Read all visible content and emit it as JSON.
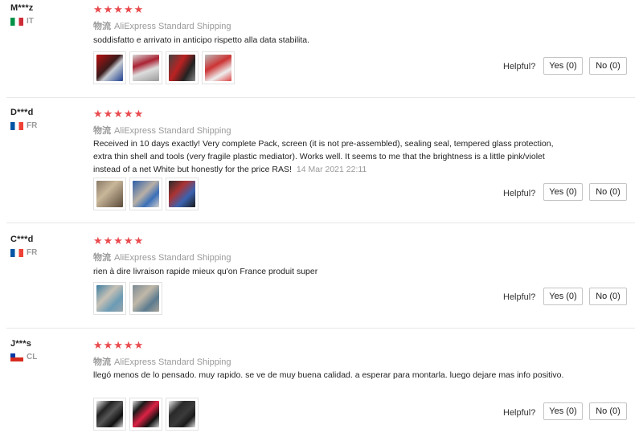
{
  "helpful_label": "Helpful?",
  "shipping_prefix": "物流",
  "reviews": [
    {
      "user": "M***z",
      "country": "IT",
      "stars": "★★★★★",
      "shipping": "AliExpress Standard Shipping",
      "text": "soddisfatto e arrivato in anticipo rispetto alla data stabilita.",
      "date": "",
      "yes_label": "Yes (0)",
      "no_label": "No (0)"
    },
    {
      "user": "D***d",
      "country": "FR",
      "stars": "★★★★★",
      "shipping": "AliExpress Standard Shipping",
      "text": "Received in 10 days exactly! Very complete Pack, screen (it is not pre-assembled), sealing seal, tempered glass protection, extra thin shell and tools (very fragile plastic mediator). Works well. It seems to me that the brightness is a little pink/violet instead of a net White but honestly for the price RAS!",
      "date": "14 Mar 2021 22:11",
      "yes_label": "Yes (0)",
      "no_label": "No (0)"
    },
    {
      "user": "C***d",
      "country": "FR",
      "stars": "★★★★★",
      "shipping": "AliExpress Standard Shipping",
      "text": "rien à dire livraison rapide mieux qu'on France produit super",
      "date": "",
      "yes_label": "Yes (0)",
      "no_label": "No (0)"
    },
    {
      "user": "J***s",
      "country": "CL",
      "stars": "★★★★★",
      "shipping": "AliExpress Standard Shipping",
      "text": "llegó menos de lo pensado. muy rapido. se ve de muy buena calidad. a esperar para montarla. luego dejare mas info positivo.",
      "date": "",
      "yes_label": "Yes (0)",
      "no_label": "No (0)"
    }
  ]
}
